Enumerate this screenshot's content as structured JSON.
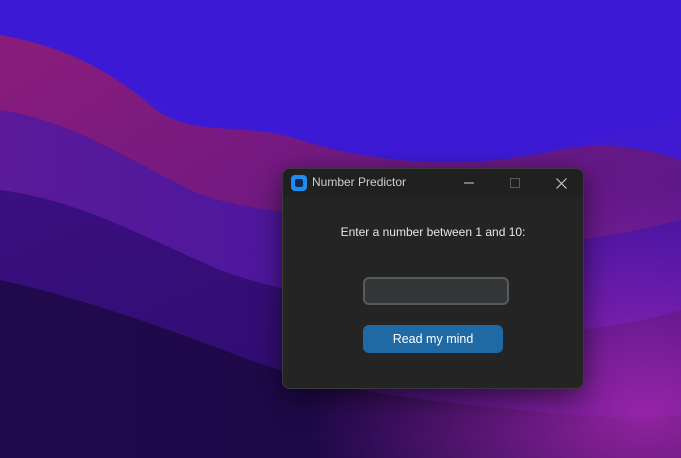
{
  "window": {
    "title": "Number Predictor",
    "icon": "app-icon",
    "controls": [
      "minimize-icon",
      "maximize-icon",
      "close-icon"
    ]
  },
  "main": {
    "prompt": "Enter a number between 1 and 10:",
    "input_value": "",
    "button_label": "Read my mind"
  },
  "colors": {
    "window_bg": "#242424",
    "titlebar_bg": "#202020",
    "button_bg": "#1f6aa5",
    "input_bg": "#343638",
    "input_border": "#565b5e",
    "app_icon": "#1e8cf0"
  }
}
